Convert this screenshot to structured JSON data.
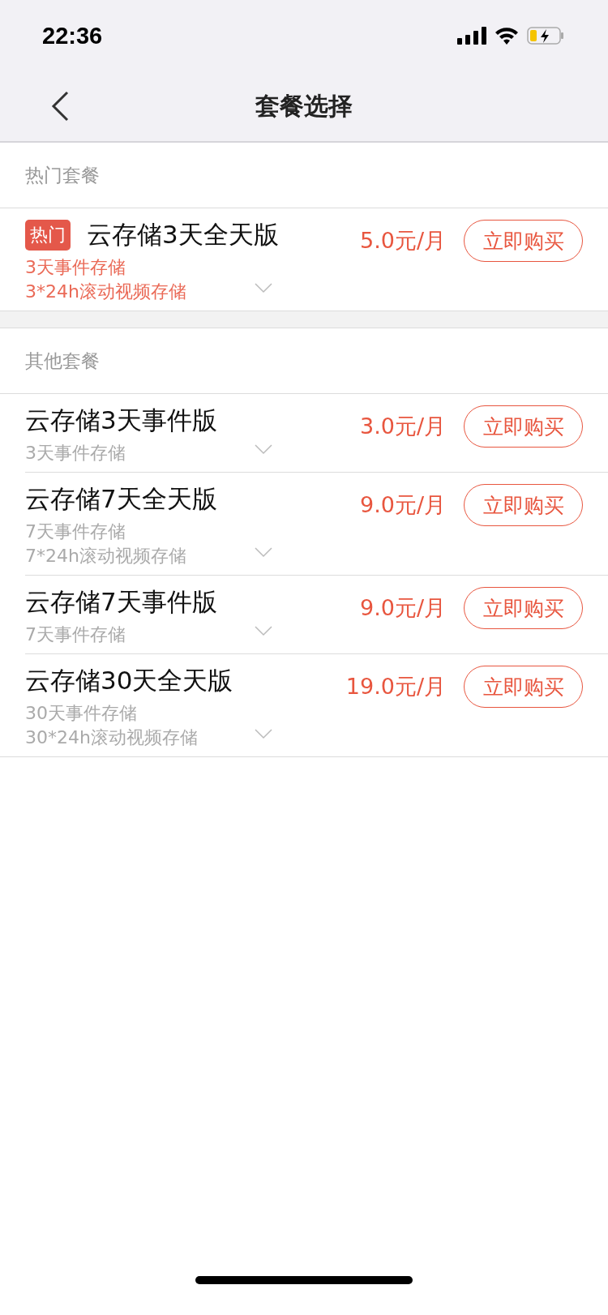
{
  "status_bar": {
    "time": "22:36"
  },
  "nav": {
    "title": "套餐选择"
  },
  "sections": [
    {
      "title": "热门套餐",
      "plans": [
        {
          "badge": "热门",
          "highlighted": true,
          "name": "云存储3天全天版",
          "price": "5.0元/月",
          "features": [
            "3天事件存储",
            "3*24h滚动视频存储"
          ],
          "button": "立即购买"
        }
      ]
    },
    {
      "title": "其他套餐",
      "plans": [
        {
          "highlighted": false,
          "name": "云存储3天事件版",
          "price": "3.0元/月",
          "features": [
            "3天事件存储"
          ],
          "button": "立即购买"
        },
        {
          "highlighted": false,
          "name": "云存储7天全天版",
          "price": "9.0元/月",
          "features": [
            "7天事件存储",
            "7*24h滚动视频存储"
          ],
          "button": "立即购买"
        },
        {
          "highlighted": false,
          "name": "云存储7天事件版",
          "price": "9.0元/月",
          "features": [
            "7天事件存储"
          ],
          "button": "立即购买"
        },
        {
          "highlighted": false,
          "name": "云存储30天全天版",
          "price": "19.0元/月",
          "features": [
            "30天事件存储",
            "30*24h滚动视频存储"
          ],
          "button": "立即购买"
        }
      ]
    }
  ]
}
